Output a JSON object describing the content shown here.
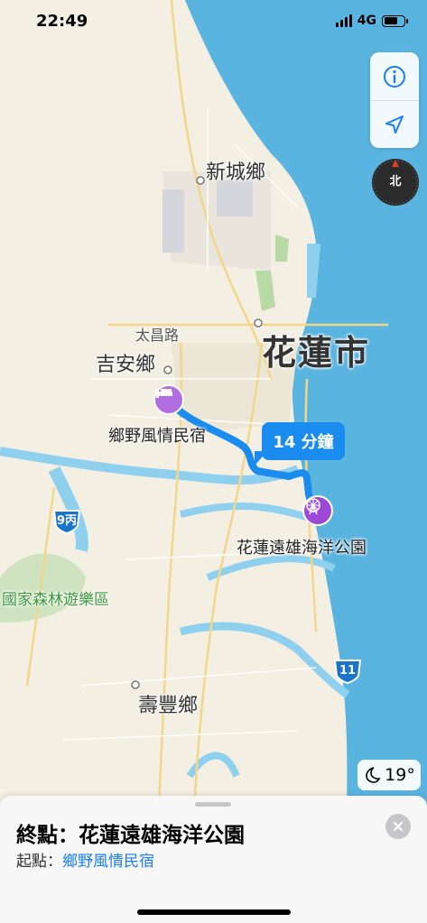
{
  "status_bar": {
    "time": "22:49",
    "network": "4G",
    "battery_level": 0.7
  },
  "map": {
    "labels": {
      "xincheng": "新城鄉",
      "taichang_road": "太昌路",
      "jian": "吉安鄉",
      "hualien_city": "花蓮市",
      "shoufeng": "壽豐鄉",
      "forest_park": "國家森林遊樂區"
    },
    "origin_poi": "鄉野風情民宿",
    "destination_poi": "花蓮遠雄海洋公園",
    "eta": "14 分鐘",
    "route_shields": [
      {
        "id": "9c",
        "text": "9丙",
        "color": "#1a74c9"
      },
      {
        "id": "11",
        "text": "11",
        "color": "#1a74c9"
      }
    ],
    "colors": {
      "route": "#1a8cf0",
      "sea": "#5ab4e0",
      "origin_pin": "#b26ee0",
      "destination_pin": "#9b49d6"
    }
  },
  "controls": {
    "info_icon": "info-icon",
    "location_icon": "location-arrow-icon",
    "compass_label": "北"
  },
  "weather": {
    "icon": "moon-icon",
    "temp": "19°"
  },
  "sheet": {
    "destination_line": "終點：花蓮遠雄海洋公園",
    "origin_prefix": "起點：",
    "origin_name": "鄉野風情民宿"
  }
}
